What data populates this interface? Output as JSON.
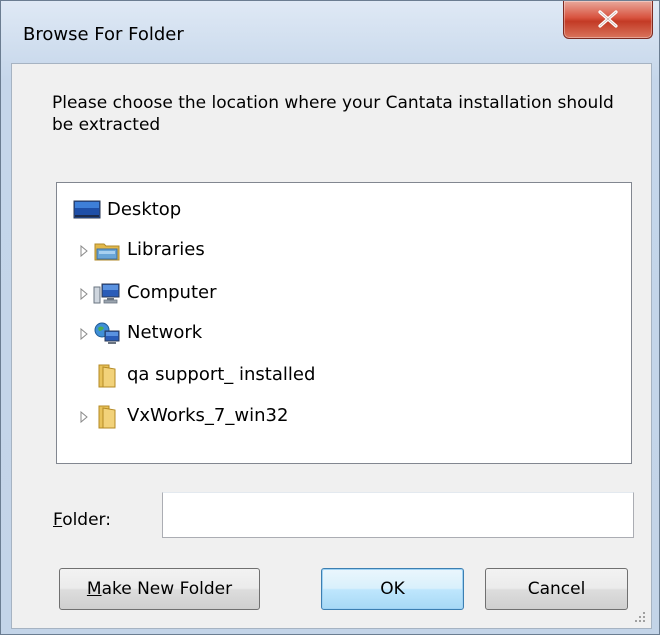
{
  "dialog": {
    "title": "Browse For Folder",
    "close_label": "x",
    "prompt": "Please choose the location where your Cantata installation should be extracted",
    "tree": {
      "items": [
        {
          "label": "Desktop",
          "icon": "desktop-icon",
          "expandable": false
        },
        {
          "label": "Libraries",
          "icon": "libraries-icon",
          "expandable": true
        },
        {
          "label": "Computer",
          "icon": "computer-icon",
          "expandable": true
        },
        {
          "label": "Network",
          "icon": "network-icon",
          "expandable": true
        },
        {
          "label": "qa support_ installed",
          "icon": "folder-icon",
          "expandable": false
        },
        {
          "label": "VxWorks_7_win32",
          "icon": "folder-icon",
          "expandable": true
        }
      ]
    },
    "folder_field": {
      "label_accel": "F",
      "label_rest": "older:",
      "value": "",
      "placeholder": ""
    },
    "buttons": {
      "make_new_folder_accel": "M",
      "make_new_folder_rest": "ake New Folder",
      "ok": "OK",
      "cancel": "Cancel"
    }
  }
}
